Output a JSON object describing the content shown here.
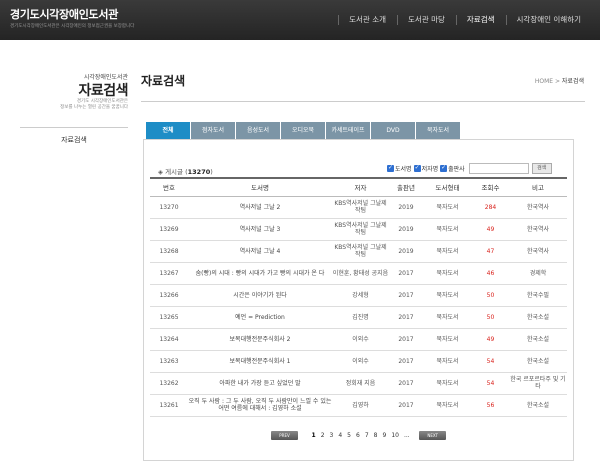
{
  "header": {
    "logo": "경기도시각장애인도서관",
    "logo_sub": "경기도시각장애인도서관은 시각장애인의 정보접근권을 보장합니다",
    "nav": [
      "도서관 소개",
      "도서관 마당",
      "자료검색",
      "시각장애인 이해하기"
    ]
  },
  "sidebar": {
    "small_title": "시각장애인도서관",
    "big_title": "자료검색",
    "desc1": "경기도 시각장애인도서관은",
    "desc2": "정보를 나누는 열린 공간을 꿈꿉니다",
    "item": "자료검색"
  },
  "main": {
    "title": "자료검색",
    "breadcrumb_home": "HOME",
    "breadcrumb_sep": ">",
    "breadcrumb_current": "자료검색"
  },
  "tabs": [
    "전체",
    "점자도서",
    "음성도서",
    "오디오북",
    "카세트테이프",
    "DVD",
    "묵자도서"
  ],
  "list": {
    "count_label": "게시글",
    "count_value": "13270",
    "filter_labels": [
      "도서명",
      "저자명",
      "출판사"
    ],
    "search_value": "",
    "search_button": "검색"
  },
  "table": {
    "headers": [
      "번호",
      "도서명",
      "저자",
      "출판년",
      "도서형태",
      "조회수",
      "비고"
    ],
    "rows": [
      {
        "no": "13270",
        "title": "역사저널 그날 2",
        "author": "KBS역사저널 그날제작팀",
        "year": "2019",
        "type": "묵자도서",
        "hits": "284",
        "note": "한국역사"
      },
      {
        "no": "13269",
        "title": "역사저널 그날 3",
        "author": "KBS역사저널 그날제작팀",
        "year": "2019",
        "type": "묵자도서",
        "hits": "49",
        "note": "한국역사"
      },
      {
        "no": "13268",
        "title": "역사저널 그날 4",
        "author": "KBS역사저널 그날제작팀",
        "year": "2019",
        "type": "묵자도서",
        "hits": "47",
        "note": "한국역사"
      },
      {
        "no": "13267",
        "title": "숨(빵)의 시대 : 빵의 시대가 가고 빵의 시대가 온 다",
        "author": "이현훈, 황태성 공지음",
        "year": "2017",
        "type": "묵자도서",
        "hits": "46",
        "note": "경제학"
      },
      {
        "no": "13266",
        "title": "시간은 이야기가 된다",
        "author": "강세형",
        "year": "2017",
        "type": "묵자도서",
        "hits": "50",
        "note": "한국수필"
      },
      {
        "no": "13265",
        "title": "예언 = Prediction",
        "author": "김진명",
        "year": "2017",
        "type": "묵자도서",
        "hits": "50",
        "note": "한국소설"
      },
      {
        "no": "13264",
        "title": "보복대행전문주식회사 2",
        "author": "이외수",
        "year": "2017",
        "type": "묵자도서",
        "hits": "49",
        "note": "한국소설"
      },
      {
        "no": "13263",
        "title": "보복대행전문주식회사 1",
        "author": "이외수",
        "year": "2017",
        "type": "묵자도서",
        "hits": "54",
        "note": "한국소설"
      },
      {
        "no": "13262",
        "title": "아파한 내가 가장 듣고 싶었던 말",
        "author": "정회재 지음",
        "year": "2017",
        "type": "묵자도서",
        "hits": "54",
        "note": "한국 르포르타주 및 기타"
      },
      {
        "no": "13261",
        "title": "오직 두 사람 : 그 두 사람, 오직 두 사람만이 느낄 수 있는 어떤 여름에 대해서 : 김영하 소설",
        "author": "김영하",
        "year": "2017",
        "type": "묵자도서",
        "hits": "56",
        "note": "한국소설"
      }
    ]
  },
  "pager": {
    "prev": "PREV",
    "next": "NEXT",
    "pages": [
      "1",
      "2",
      "3",
      "4",
      "5",
      "6",
      "7",
      "8",
      "9",
      "10"
    ],
    "current": "1",
    "more": "..."
  },
  "colors": {
    "header_bg": "#2c2c2c",
    "tab": "#7c95a6",
    "tab_active": "#1e8dc6",
    "hits": "#d9221c"
  }
}
